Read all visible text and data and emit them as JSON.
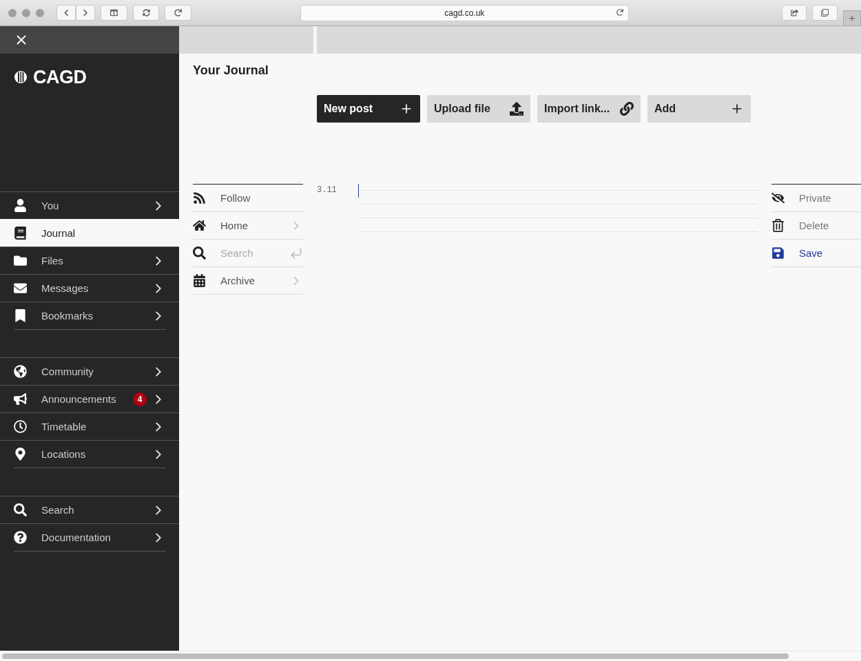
{
  "browser": {
    "url": "cagd.co.uk"
  },
  "sidebar": {
    "logo": "CAGD",
    "groups": [
      {
        "items": [
          {
            "label": "You",
            "selected": false
          },
          {
            "label": "Journal",
            "selected": true
          },
          {
            "label": "Files",
            "selected": false
          },
          {
            "label": "Messages",
            "selected": false
          },
          {
            "label": "Bookmarks",
            "selected": false
          }
        ]
      },
      {
        "items": [
          {
            "label": "Community",
            "selected": false
          },
          {
            "label": "Announcements",
            "selected": false,
            "badge": "4"
          },
          {
            "label": "Timetable",
            "selected": false
          },
          {
            "label": "Locations",
            "selected": false
          }
        ]
      },
      {
        "items": [
          {
            "label": "Search",
            "selected": false
          },
          {
            "label": "Documentation",
            "selected": false
          }
        ]
      }
    ]
  },
  "page": {
    "title": "Your Journal"
  },
  "toolbar": [
    {
      "label": "New post",
      "kind": "primary"
    },
    {
      "label": "Upload file",
      "kind": "secondary"
    },
    {
      "label": "Import link...",
      "kind": "secondary"
    },
    {
      "label": "Add",
      "kind": "secondary"
    }
  ],
  "journal_nav": [
    {
      "label": "Follow",
      "kind": "action"
    },
    {
      "label": "Home",
      "kind": "link"
    },
    {
      "placeholder": "Search",
      "kind": "search"
    },
    {
      "label": "Archive",
      "kind": "link"
    }
  ],
  "editor": {
    "line_number": "3.11"
  },
  "actions": [
    {
      "label": "Private",
      "highlighted": false
    },
    {
      "label": "Delete",
      "highlighted": false
    },
    {
      "label": "Save",
      "highlighted": true
    }
  ]
}
